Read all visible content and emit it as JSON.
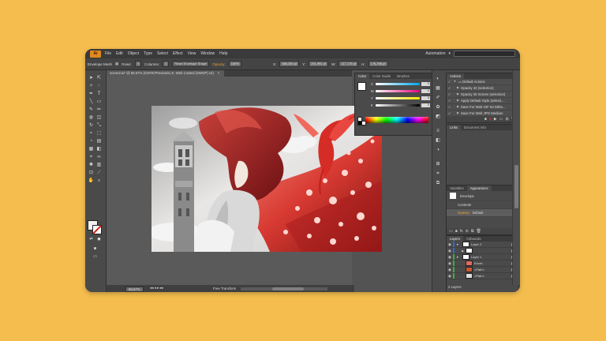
{
  "menubar": {
    "logo": "Ai",
    "items": [
      "File",
      "Edit",
      "Object",
      "Type",
      "Select",
      "Effect",
      "View",
      "Window",
      "Help"
    ],
    "workspace": "Automation"
  },
  "control_bar": {
    "mode": "Envelope Mesh",
    "rows_label": "Rows:",
    "rows_value": "4",
    "columns_label": "Columns:",
    "columns_value": "4",
    "reset_button": "Reset Envelope Shape",
    "opacity_label": "Opacity:",
    "opacity_value": "100%",
    "x_label": "X:",
    "x_value": "386,250 pt",
    "y_label": "Y:",
    "y_value": "251,991 pt",
    "w_label": "W:",
    "w_value": "117,175 pt",
    "h_label": "H:",
    "h_value": "176,298 pt"
  },
  "document": {
    "tab_title": "scene2.ai* @ 66.67% (CMYK/Preview/U.S. Web Coated (SWOP) v2)",
    "close_glyph": "×"
  },
  "status": {
    "zoom": "66,67%",
    "tool_status": "Free Transform",
    "nav_glyphs": "◂◂ ◂ ▸ ▸▸"
  },
  "color_panel": {
    "tabs": [
      "Color",
      "Color Guide",
      "Brushes"
    ],
    "channels": [
      {
        "label": "C",
        "value": "0",
        "unit": "%"
      },
      {
        "label": "M",
        "value": "0",
        "unit": "%"
      },
      {
        "label": "Y",
        "value": "0",
        "unit": "%"
      },
      {
        "label": "K",
        "value": "0",
        "unit": "%"
      }
    ]
  },
  "actions_panel": {
    "tab": "Actions",
    "items": [
      {
        "check": "✓",
        "name": "Default Actions",
        "folder": true
      },
      {
        "check": "✓",
        "name": "Opacity 40 (selection)",
        "folder": false
      },
      {
        "check": "✓",
        "name": "Opacity 40 Screen (selection)",
        "folder": false
      },
      {
        "check": "✓",
        "name": "Apply Default Style (selecti...",
        "folder": false
      },
      {
        "check": "✓",
        "name": "Save For Web GIF 64 Dithe...",
        "folder": false
      },
      {
        "check": "✓",
        "name": "Save For Web JPG Medium",
        "folder": false
      }
    ]
  },
  "links_panel": {
    "tabs": [
      "Links",
      "Document Info"
    ]
  },
  "appearance_panel": {
    "tabs": [
      "Variables",
      "Appearance"
    ],
    "target": "Envelope",
    "contents": "Contents",
    "opacity_label": "Opacity:",
    "opacity_value": "Default"
  },
  "layers_panel": {
    "tabs": [
      "Layers",
      "Artboards"
    ],
    "rows": [
      {
        "name": "Layer 2",
        "color": "#2f6dd3"
      },
      {
        "name": "",
        "color": "#2f6dd3"
      },
      {
        "name": "Layer 1",
        "color": "#3cb040"
      },
      {
        "name": "Envel...",
        "color": "#3cb040"
      },
      {
        "name": "<Path>",
        "color": "#3cb040"
      },
      {
        "name": "<Path>",
        "color": "#3cb040"
      }
    ],
    "count": "2 Layers"
  },
  "colors": {
    "background": "#f4bd4e",
    "accent_red": "#d0231d"
  }
}
